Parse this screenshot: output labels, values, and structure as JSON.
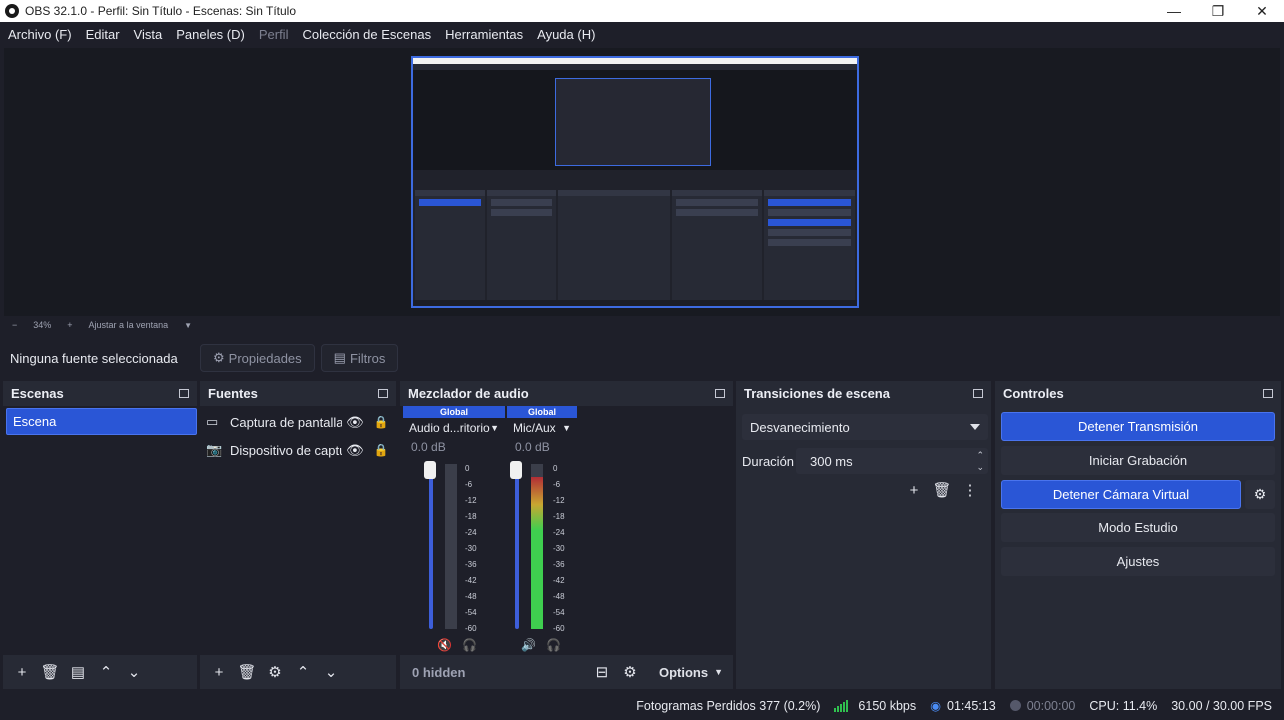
{
  "window": {
    "title": "OBS 32.1.0 - Perfil: Sin Título - Escenas: Sin Título",
    "minimize": "—",
    "maximize": "❐",
    "close": "✕"
  },
  "menu": [
    "Archivo (F)",
    "Editar",
    "Vista",
    "Paneles (D)",
    "Perfil",
    "Colección de Escenas",
    "Herramientas",
    "Ayuda (H)"
  ],
  "menu_disabled_index": 4,
  "zoom": {
    "minus": "−",
    "level": "34%",
    "plus": "+",
    "fit": "Ajustar a la ventana"
  },
  "source_toolbar": {
    "no_source": "Ninguna fuente seleccionada",
    "properties": "Propiedades",
    "filters": "Filtros"
  },
  "scenes": {
    "title": "Escenas",
    "items": [
      "Escena"
    ]
  },
  "sources": {
    "title": "Fuentes",
    "items": [
      {
        "name": "Captura de pantalla",
        "icon": "monitor-icon"
      },
      {
        "name": "Dispositivo de captura",
        "icon": "camera-icon"
      }
    ]
  },
  "mixer": {
    "title": "Mezclador de audio",
    "channels": [
      {
        "tag": "Global",
        "name": "Audio d...ritorio",
        "db": "0.0 dB",
        "muted": true,
        "level": 0.0
      },
      {
        "tag": "Global",
        "name": "Mic/Aux",
        "db": "0.0 dB",
        "muted": false,
        "level": 0.92
      }
    ],
    "ticks": [
      "0",
      "-6",
      "-12",
      "-18",
      "-24",
      "-30",
      "-36",
      "-42",
      "-48",
      "-54",
      "-60"
    ],
    "hidden": "0 hidden",
    "options": "Options"
  },
  "transitions": {
    "title": "Transiciones de escena",
    "selected": "Desvanecimiento",
    "duration_label": "Duración",
    "duration_value": "300 ms"
  },
  "controls": {
    "title": "Controles",
    "stop_stream": "Detener Transmisión",
    "start_record": "Iniciar Grabación",
    "stop_vcam": "Detener Cámara Virtual",
    "studio_mode": "Modo Estudio",
    "settings": "Ajustes"
  },
  "status": {
    "dropped": "Fotogramas Perdidos 377 (0.2%)",
    "bitrate": "6150 kbps",
    "stream_time": "01:45:13",
    "record_time": "00:00:00",
    "cpu": "CPU: 11.4%",
    "fps": "30.00 / 30.00 FPS"
  },
  "colors": {
    "accent": "#2a56d6",
    "panel": "#272a35",
    "background": "#1e1f29",
    "meter_green": "#3fcf4f"
  }
}
